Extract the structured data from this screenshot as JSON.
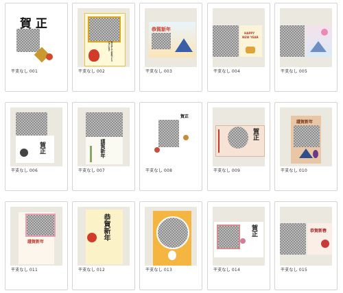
{
  "items": [
    {
      "label": "干支なし 001"
    },
    {
      "label": "干支なし 002"
    },
    {
      "label": "干支なし 003"
    },
    {
      "label": "干支なし 004"
    },
    {
      "label": "干支なし 005"
    },
    {
      "label": "干支なし 006"
    },
    {
      "label": "干支なし 007"
    },
    {
      "label": "干支なし 008"
    },
    {
      "label": "干支なし 009"
    },
    {
      "label": "干支なし 010"
    },
    {
      "label": "干支なし 011"
    },
    {
      "label": "干支なし 012"
    },
    {
      "label": "干支なし 013"
    },
    {
      "label": "干支なし 014"
    },
    {
      "label": "干支なし 015"
    }
  ],
  "card_text": {
    "c1": "賀 正",
    "c2": "あけましておめでとうございます",
    "c3": "恭賀新年",
    "c4a": "HAPPY",
    "c4b": "NEW YEAR",
    "c6": "賀正",
    "c7": "謹賀新年",
    "c8": "賀正",
    "c9": "賀正",
    "c10": "謹賀新年",
    "c11": "謹賀新年",
    "c12": "恭賀新年",
    "c14": "賀正",
    "c15": "恭賀新春"
  },
  "colors": {
    "card_border": "#d4d4d4",
    "thumb_bg": "#ebe9df",
    "label": "#333333",
    "photo_dark": "#8d8d8d",
    "photo_light": "#bdbdbd"
  }
}
